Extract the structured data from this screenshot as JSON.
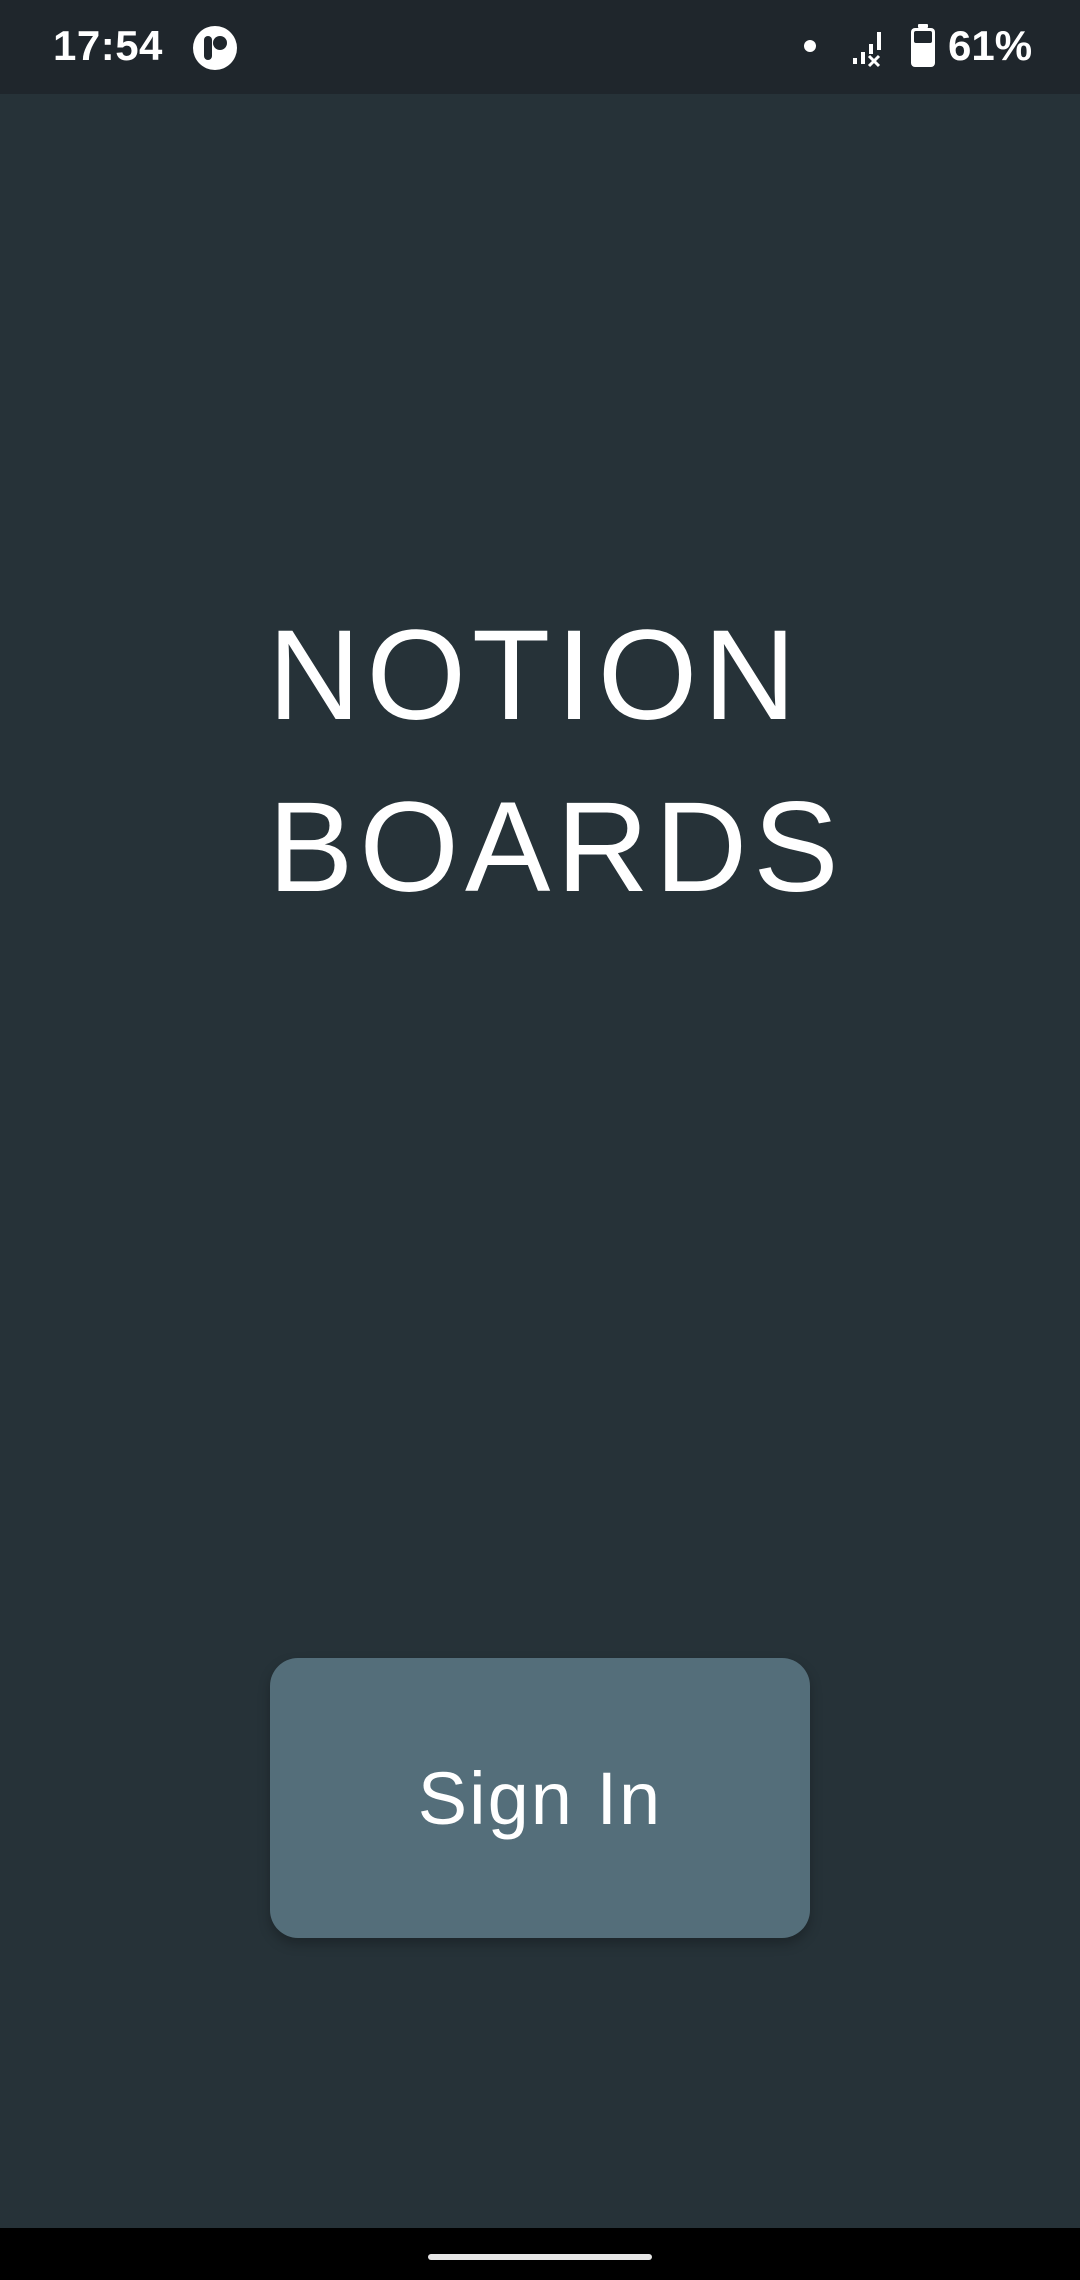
{
  "status_bar": {
    "time": "17:54",
    "battery_percent": "61%",
    "icons": [
      "app-notification-icon",
      "dot-icon",
      "signal-no-data-icon",
      "battery-icon"
    ]
  },
  "app": {
    "title_line1": "NOTION",
    "title_line2": "BOARDS"
  },
  "actions": {
    "sign_in_label": "Sign In"
  },
  "colors": {
    "background": "#263238",
    "status_bar": "#1f262c",
    "button": "#546e7a",
    "text": "#ffffff"
  }
}
